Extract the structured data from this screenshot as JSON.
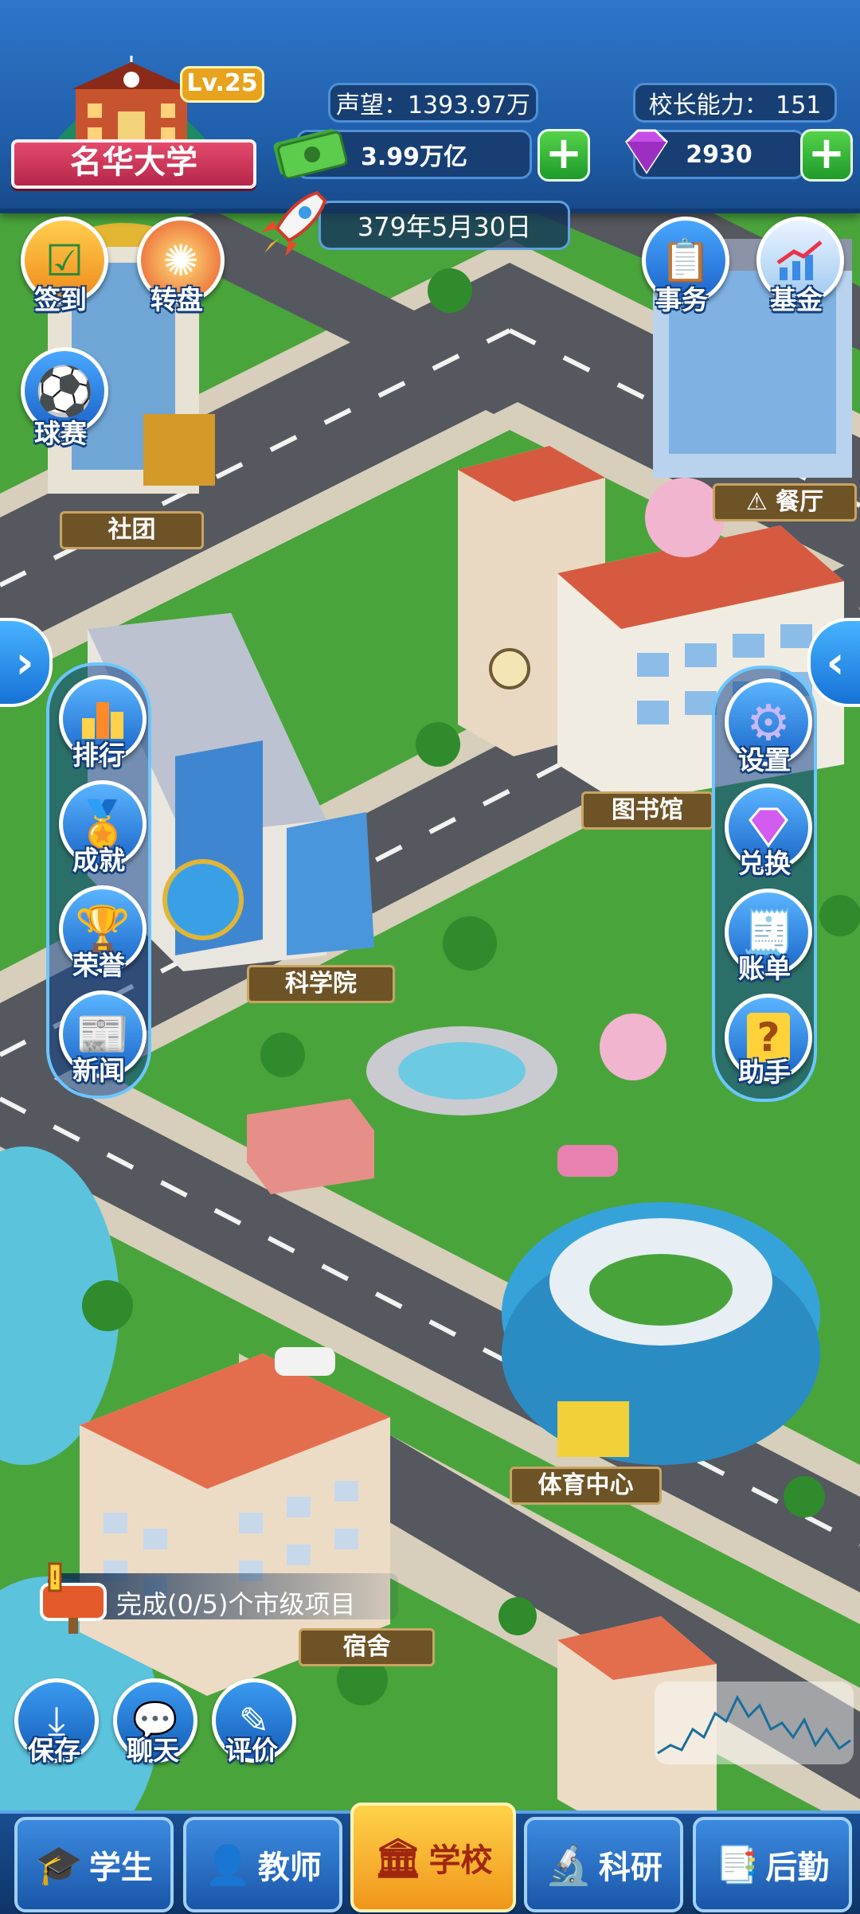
{
  "school": {
    "name": "名华大学",
    "level": "Lv.25"
  },
  "stats": {
    "reputation": "声望：1393.97万",
    "principal_ability": "校长能力：  151",
    "money": "3.99万亿",
    "gems": "2930"
  },
  "date": "379年5月30日",
  "left_top_buttons": [
    {
      "label": "签到",
      "icon": "calendar-check-icon"
    },
    {
      "label": "转盘",
      "icon": "wheel-icon"
    },
    {
      "label": "球赛",
      "icon": "soccer-ball-icon"
    }
  ],
  "right_top_buttons": [
    {
      "label": "事务",
      "icon": "clipboard-icon"
    },
    {
      "label": "基金",
      "icon": "chart-up-icon"
    }
  ],
  "left_panel": [
    {
      "label": "排行",
      "icon": "podium-icon"
    },
    {
      "label": "成就",
      "icon": "medal-icon"
    },
    {
      "label": "荣誉",
      "icon": "trophy-icon"
    },
    {
      "label": "新闻",
      "icon": "newspaper-icon"
    }
  ],
  "right_panel": [
    {
      "label": "设置",
      "icon": "gear-icon"
    },
    {
      "label": "兑换",
      "icon": "gem-icon"
    },
    {
      "label": "账单",
      "icon": "bill-icon"
    },
    {
      "label": "助手",
      "icon": "help-icon"
    }
  ],
  "buildings": {
    "club": "社团",
    "restaurant": "餐厅",
    "library": "图书馆",
    "science": "科学院",
    "sports": "体育中心",
    "dorm": "宿舍"
  },
  "task": "完成(0/5)个市级项目",
  "bottom_small": [
    {
      "label": "保存",
      "icon": "download-icon"
    },
    {
      "label": "聊天",
      "icon": "chat-icon"
    },
    {
      "label": "评价",
      "icon": "review-icon"
    }
  ],
  "nav": [
    {
      "label": "学生",
      "icon": "graduation-cap-icon",
      "active": false
    },
    {
      "label": "教师",
      "icon": "teacher-icon",
      "active": false
    },
    {
      "label": "学校",
      "icon": "school-columns-icon",
      "active": true
    },
    {
      "label": "科研",
      "icon": "microscope-icon",
      "active": false
    },
    {
      "label": "后勤",
      "icon": "logistics-icon",
      "active": false
    }
  ],
  "colors": {
    "topbar": "#2e77c9",
    "nav_active": "#f0961a",
    "road": "#55585e",
    "grass": "#4aa43c"
  }
}
